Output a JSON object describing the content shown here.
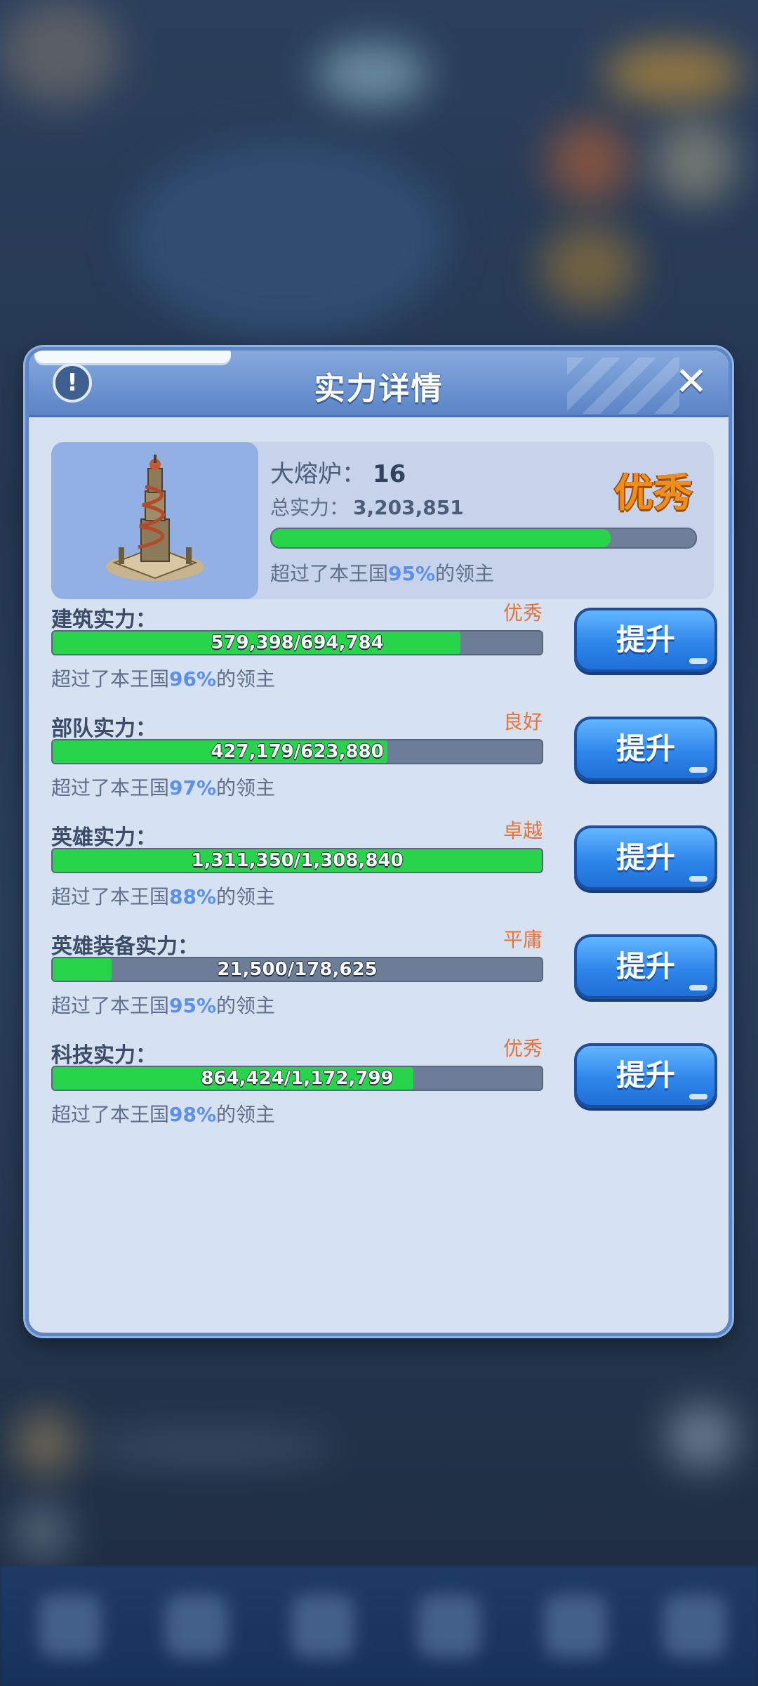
{
  "dialog": {
    "title": "实力详情",
    "info_icon": "exclamation-icon",
    "close_icon": "close-x-icon"
  },
  "summary": {
    "building_label": "大熔炉：",
    "building_level": "16",
    "total_label": "总实力：",
    "total_value": "3,203,851",
    "grade": "优秀",
    "progress": 0.8,
    "rank_prefix": "超过了本王国",
    "rank_pct": "95%",
    "rank_suffix": "的领主"
  },
  "rows": [
    {
      "label": "建筑实力：",
      "grade": "优秀",
      "value": "579,398/694,784",
      "progress": 0.834,
      "rank_prefix": "超过了本王国",
      "rank_pct": "96%",
      "rank_suffix": "的领主",
      "button": "提升"
    },
    {
      "label": "部队实力：",
      "grade": "良好",
      "value": "427,179/623,880",
      "progress": 0.685,
      "rank_prefix": "超过了本王国",
      "rank_pct": "97%",
      "rank_suffix": "的领主",
      "button": "提升"
    },
    {
      "label": "英雄实力：",
      "grade": "卓越",
      "value": "1,311,350/1,308,840",
      "progress": 1.0,
      "rank_prefix": "超过了本王国",
      "rank_pct": "88%",
      "rank_suffix": "的领主",
      "button": "提升"
    },
    {
      "label": "英雄装备实力：",
      "grade": "平庸",
      "value": "21,500/178,625",
      "progress": 0.12,
      "rank_prefix": "超过了本王国",
      "rank_pct": "95%",
      "rank_suffix": "的领主",
      "button": "提升"
    },
    {
      "label": "科技实力：",
      "grade": "优秀",
      "value": "864,424/1,172,799",
      "progress": 0.737,
      "rank_prefix": "超过了本王国",
      "rank_pct": "98%",
      "rank_suffix": "的领主",
      "button": "提升"
    }
  ],
  "colors": {
    "accent_green": "#27d44a",
    "grade_orange": "#e7723b",
    "pct_blue": "#5b8ff0",
    "button_blue": "#2f86ea"
  }
}
